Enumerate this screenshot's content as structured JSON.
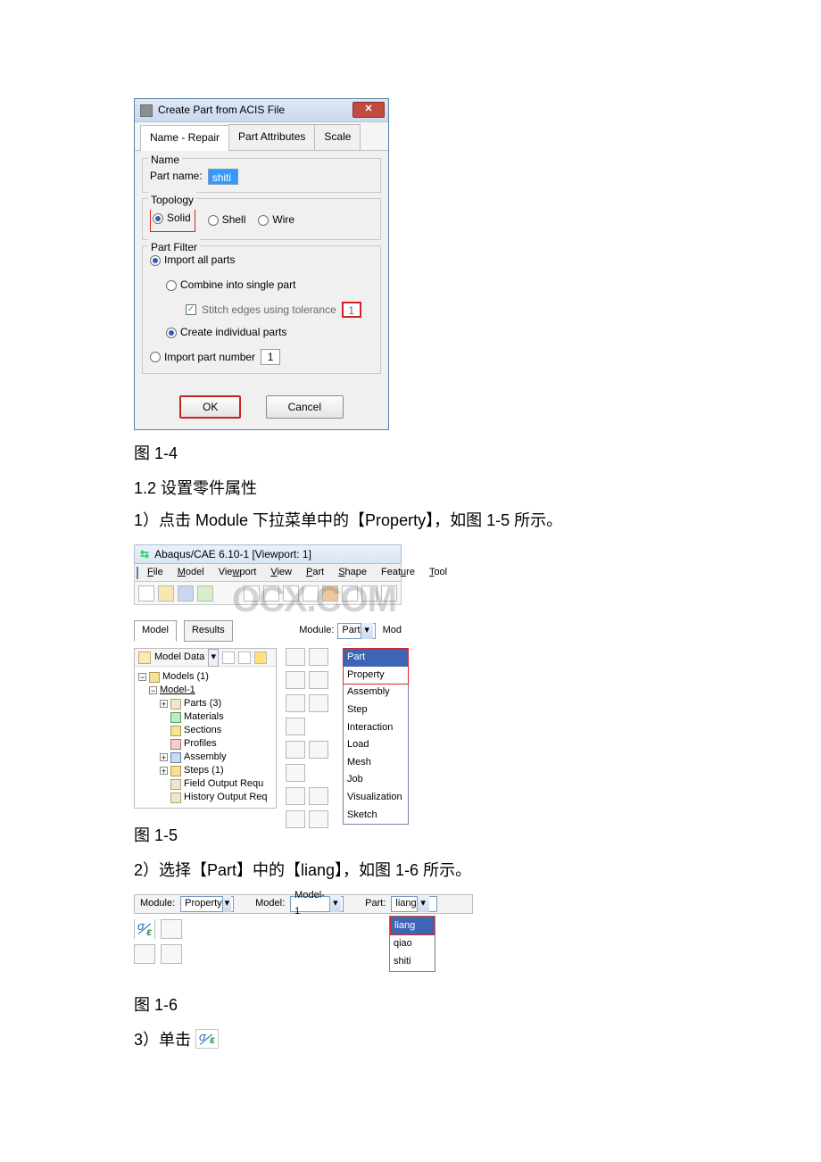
{
  "dialog": {
    "title": "Create Part from ACIS File",
    "close_glyph": "✕",
    "tabs": {
      "t1": "Name - Repair",
      "t2": "Part Attributes",
      "t3": "Scale"
    },
    "name_group": {
      "legend": "Name",
      "label": "Part name:",
      "value": "shiti"
    },
    "topology_group": {
      "legend": "Topology",
      "solid": "Solid",
      "shell": "Shell",
      "wire": "Wire"
    },
    "filter_group": {
      "legend": "Part Filter",
      "import_all": "Import all parts",
      "combine": "Combine into single part",
      "stitch": "Stitch edges using tolerance",
      "stitch_val": "1",
      "create_indiv": "Create individual parts",
      "import_num": "Import part number",
      "import_num_val": "1"
    },
    "buttons": {
      "ok": "OK",
      "cancel": "Cancel"
    }
  },
  "captions": {
    "c14": "图 1-4",
    "c15": "图 1-5",
    "c16": "图 1-6"
  },
  "sections": {
    "s12": "1.2 设置零件属性",
    "step1": "1）点击 Module 下拉菜单中的【Property】，如图 1-5 所示。",
    "step2": "2）选择【Part】中的【liang】，如图 1-6 所示。",
    "step3_prefix": "3）单击"
  },
  "fig5": {
    "title": "Abaqus/CAE 6.10-1 [Viewport: 1]",
    "menus": {
      "file": "File",
      "model": "Model",
      "viewport": "Viewport",
      "view": "View",
      "part": "Part",
      "shape": "Shape",
      "feature": "Feature",
      "tool": "Tool"
    },
    "context_tabs": {
      "model": "Model",
      "results": "Results"
    },
    "module_label": "Module:",
    "module_value": "Part",
    "mod_short": "Mod",
    "dropdown": [
      "Part",
      "Property",
      "Assembly",
      "Step",
      "Interaction",
      "Load",
      "Mesh",
      "Job",
      "Visualization",
      "Sketch"
    ],
    "tree_hdr": "Model Data",
    "tree": {
      "models": "Models (1)",
      "model1": "Model-1",
      "parts": "Parts (3)",
      "materials": "Materials",
      "sections": "Sections",
      "profiles": "Profiles",
      "assembly": "Assembly",
      "steps": "Steps (1)",
      "fieldout": "Field Output Requ",
      "histout": "History Output Req"
    },
    "watermark_text": "OCX.COM"
  },
  "fig6": {
    "module_label": "Module:",
    "module_value": "Property",
    "model_label": "Model:",
    "model_value": "Model-1",
    "part_label": "Part:",
    "part_value": "liang",
    "dropdown": [
      "liang",
      "qiao",
      "shiti"
    ]
  }
}
